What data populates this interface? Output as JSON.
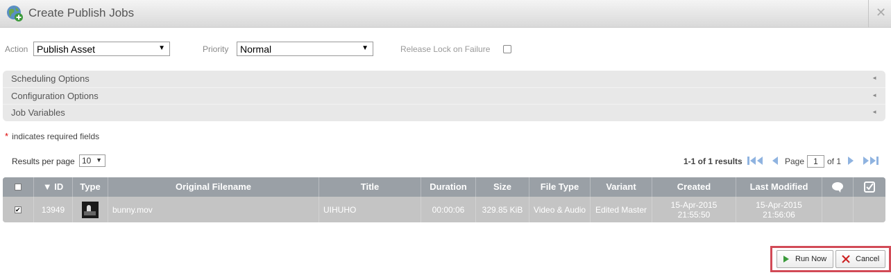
{
  "window": {
    "title": "Create Publish Jobs",
    "close_glyph": "✕"
  },
  "form": {
    "action_label": "Action",
    "action_value": "Publish Asset",
    "priority_label": "Priority",
    "priority_value": "Normal",
    "release_lock_label": "Release Lock on Failure",
    "release_lock_checked": false
  },
  "accordion": [
    {
      "label": "Scheduling Options"
    },
    {
      "label": "Configuration Options"
    },
    {
      "label": "Job Variables"
    }
  ],
  "required_note": {
    "star": "*",
    "text": "indicates required fields"
  },
  "results": {
    "per_page_label": "Results per page",
    "per_page_value": "10",
    "count_text": "1-1 of 1 results",
    "page_label": "Page",
    "page_value": "1",
    "of_label": "of 1"
  },
  "table": {
    "columns": {
      "select": "✔",
      "id": "▼ ID",
      "type": "Type",
      "filename": "Original Filename",
      "title": "Title",
      "duration": "Duration",
      "size": "Size",
      "filetype": "File Type",
      "variant": "Variant",
      "created": "Created",
      "modified": "Last Modified",
      "comment_icon": "speech-bubble-icon",
      "check_icon": "checkbox-icon"
    },
    "rows": [
      {
        "selected": true,
        "id": "13949",
        "type_icon": "video-thumbnail",
        "filename": "bunny.mov",
        "title": "UIHUHO",
        "duration": "00:00:06",
        "size": "329.85 KiB",
        "filetype": "Video & Audio",
        "variant": "Edited Master",
        "created_date": "15-Apr-2015",
        "created_time": "21:55:50",
        "modified_date": "15-Apr-2015",
        "modified_time": "21:56:06"
      }
    ]
  },
  "buttons": {
    "run_now": "Run Now",
    "cancel": "Cancel"
  },
  "colors": {
    "header_bg": "#9aa0a6",
    "row_bg": "#c4c4c4",
    "highlight": "#d24a56",
    "run_icon": "#3a9a3a",
    "cancel_icon": "#cc2222",
    "pager_icon": "#8fb3e0"
  }
}
